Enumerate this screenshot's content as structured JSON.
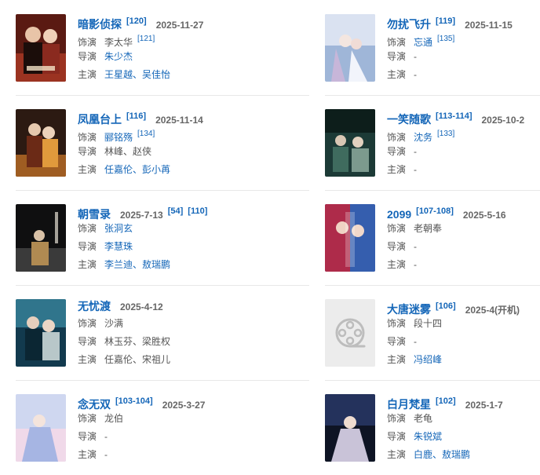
{
  "labels": {
    "role": "饰演",
    "director": "导演",
    "starring": "主演"
  },
  "dramas": [
    {
      "title": "暗影侦探",
      "ref": "[120]",
      "date": "2025-11-27",
      "role": "李太华",
      "role_ref": "[121]",
      "director": "朱少杰",
      "starring": "王星越、吴佳怡",
      "poster_colors": [
        "#5a1a12",
        "#c7442c",
        "#1b0d0a"
      ]
    },
    {
      "title": "勿扰飞升",
      "ref": "[119]",
      "date": "2025-11-15",
      "role": "忘通",
      "role_ref": "[135]",
      "director": "-",
      "starring": "-",
      "poster_colors": [
        "#9fb6d8",
        "#e9eef8",
        "#c7b6d9"
      ]
    },
    {
      "title": "凤凰台上",
      "ref": "[116]",
      "date": "2025-11-14",
      "role": "郦铭殇",
      "role_ref": "[134]",
      "director": "林峰、赵侠",
      "starring": "任嘉伦、彭小苒",
      "poster_colors": [
        "#2c1a12",
        "#d07a2a",
        "#6b2a16"
      ]
    },
    {
      "title": "一笑随歌",
      "ref": "[113-114]",
      "date": "2025-10-2",
      "role": "沈务",
      "role_ref": "[133]",
      "director": "-",
      "starring": "-",
      "poster_colors": [
        "#1c3a36",
        "#3f6b5e",
        "#0d1e1b"
      ]
    },
    {
      "title": "朝雪录",
      "date": "2025-7-13",
      "ref": "[54]",
      "ref2": "[110]",
      "role": "张洞玄",
      "director": "李慧珠",
      "starring": "李兰迪、敖瑞鹏",
      "poster_colors": [
        "#0f0f10",
        "#3a3a3a",
        "#b08a52"
      ]
    },
    {
      "title": "2099",
      "ref": "[107-108]",
      "date": "2025-5-16",
      "role": "老朝奉",
      "director": "-",
      "starring": "-",
      "poster_colors": [
        "#2a1b4a",
        "#d0304a",
        "#3b7bd9"
      ]
    },
    {
      "title": "无忧渡",
      "date": "2025-4-12",
      "role": "沙满",
      "director": "林玉芬、梁胜权",
      "starring": "任嘉伦、宋祖儿",
      "poster_colors": [
        "#123a4e",
        "#3d8fa6",
        "#b8c7c9"
      ]
    },
    {
      "title": "大唐迷雾",
      "ref": "[106]",
      "date": "2025-4(开机)",
      "role": "段十四",
      "director": "-",
      "starring": "冯绍峰",
      "poster_colors": [
        "#ececec",
        "#cfcfcf",
        "#b5b5b5"
      ]
    },
    {
      "title": "念无双",
      "ref": "[103-104]",
      "date": "2025-3-27",
      "role": "龙伯",
      "director": "-",
      "starring": "-",
      "poster_colors": [
        "#cfd7f0",
        "#f3d9e8",
        "#a6b5e3"
      ]
    },
    {
      "title": "白月梵星",
      "ref": "[102]",
      "date": "2025-1-7",
      "role": "老龟",
      "director": "朱锐斌",
      "starring": "白鹿、敖瑞鹏",
      "poster_colors": [
        "#0e1424",
        "#2b3a6a",
        "#c9c3d8"
      ]
    }
  ]
}
